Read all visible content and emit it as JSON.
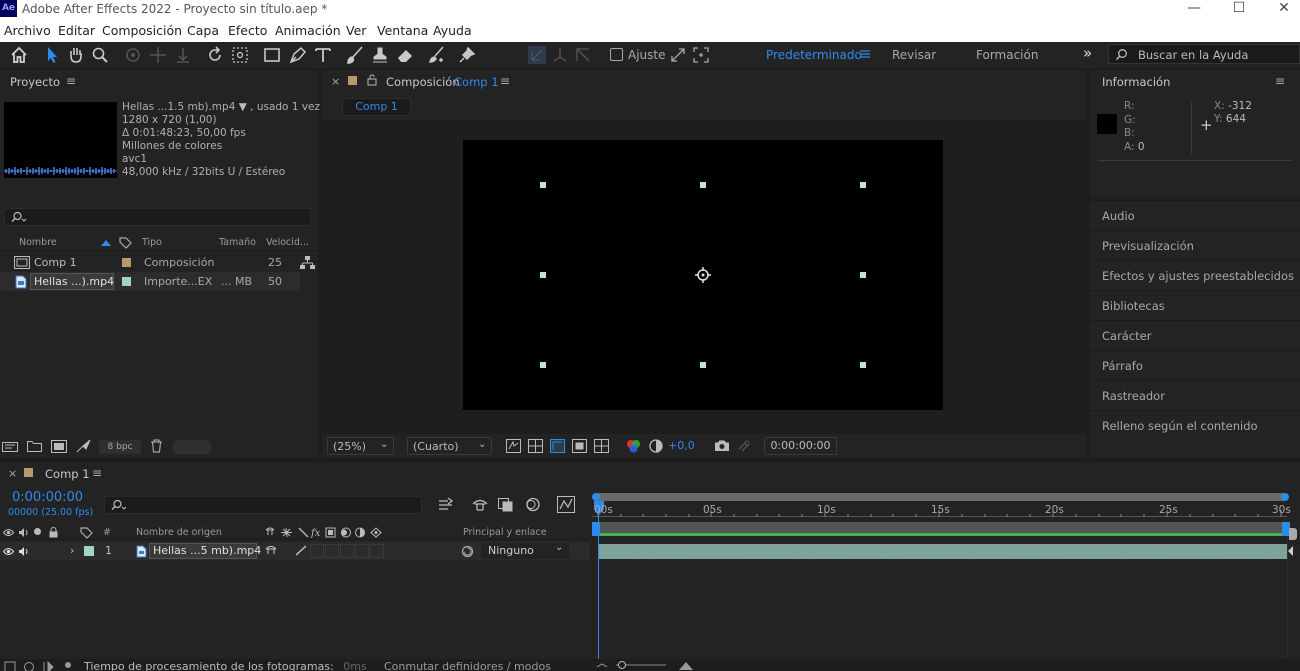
{
  "app": {
    "logo": "Ae",
    "title": "Adobe After Effects 2022 - Proyecto sin título.aep *",
    "window_controls": {
      "minimize": "—",
      "maximize": "☐",
      "close": "✕"
    }
  },
  "menubar": [
    "Archivo",
    "Editar",
    "Composición",
    "Capa",
    "Efecto",
    "Animación",
    "Ver",
    "Ventana",
    "Ayuda"
  ],
  "toolbar": {
    "tools": [
      "home-icon",
      "selection-tool-icon",
      "hand-tool-icon",
      "zoom-tool-icon",
      "orbit-camera-icon",
      "pan-camera-icon",
      "dolly-camera-icon",
      "rotation-tool-icon",
      "pan-behind-icon",
      "rectangle-tool-icon",
      "pen-tool-icon",
      "type-tool-icon",
      "brush-tool-icon",
      "clone-stamp-icon",
      "eraser-icon",
      "roto-brush-icon",
      "puppet-pin-icon"
    ],
    "snap_label": "Ajuste",
    "workspaces": [
      "Predeterminado",
      "Revisar",
      "Formación"
    ],
    "active_workspace": "Predeterminado",
    "overflow": "»",
    "help_placeholder": "Buscar en la Ayuda"
  },
  "project": {
    "title": "Proyecto",
    "menu": "≡",
    "footage": {
      "name": "Hellas ...1.5 mb).mp4",
      "usage": ", usado 1 vez",
      "dimensions": "1280 x 720 (1,00)",
      "duration": "Δ 0:01:48:23, 50,00 fps",
      "colors": "Millones de colores",
      "codec": "avc1",
      "audio": "48,000 kHz / 32bits U / Estéreo"
    },
    "search_placeholder": "",
    "columns": {
      "name": "Nombre",
      "type": "Tipo",
      "size": "Tamaño",
      "speed": "Velocid..."
    },
    "items": [
      {
        "name": "Comp 1",
        "type": "Composición",
        "size": "",
        "speed": "25",
        "swatch": "#b59a6e"
      },
      {
        "name": "Hellas ...).mp4",
        "type": "Importe...EX",
        "size": "... MB",
        "speed": "50",
        "swatch": "#9fd4c9"
      }
    ],
    "bpc": "8 bpc"
  },
  "composition": {
    "panel_label": "Composición",
    "comp_name": "Comp 1",
    "tab": "Comp 1",
    "zoom": "(25%)",
    "resolution": "(Cuarto)",
    "exposure": "+0,0",
    "timecode": "0:00:00:00"
  },
  "info": {
    "title": "Información",
    "r_label": "R:",
    "g_label": "G:",
    "b_label": "B:",
    "a_label": "A:",
    "a_value": "0",
    "x_label": "X:",
    "x_value": "-312",
    "y_label": "Y:",
    "y_value": "644",
    "crosshair": "+"
  },
  "right_panels": [
    "Audio",
    "Previsualización",
    "Efectos y ajustes preestablecidos",
    "Bibliotecas",
    "Carácter",
    "Párrafo",
    "Rastreador",
    "Relleno según el contenido"
  ],
  "timeline": {
    "tab": "Comp 1",
    "timecode": "0:00:00:00",
    "frames": "00000 (25.00 fps)",
    "search_placeholder": "",
    "columns": {
      "num": "#",
      "source": "Nombre de origen",
      "parent": "Principal y enlace"
    },
    "ruler": [
      "00s",
      "05s",
      "10s",
      "15s",
      "20s",
      "25s",
      "30s"
    ],
    "layer": {
      "num": "1",
      "name": "Hellas ...5 mb).mp4",
      "parent": "Ninguno"
    }
  },
  "statusbar": {
    "render_time_label": "Tiempo de procesamiento de los fotogramas:",
    "render_time_value": "0ms",
    "toggle_label": "Conmutar definidores / modos"
  },
  "colors": {
    "accent": "#2d8ceb",
    "layer_bar": "#9fd4c9",
    "comp_swatch": "#b59a6e"
  }
}
